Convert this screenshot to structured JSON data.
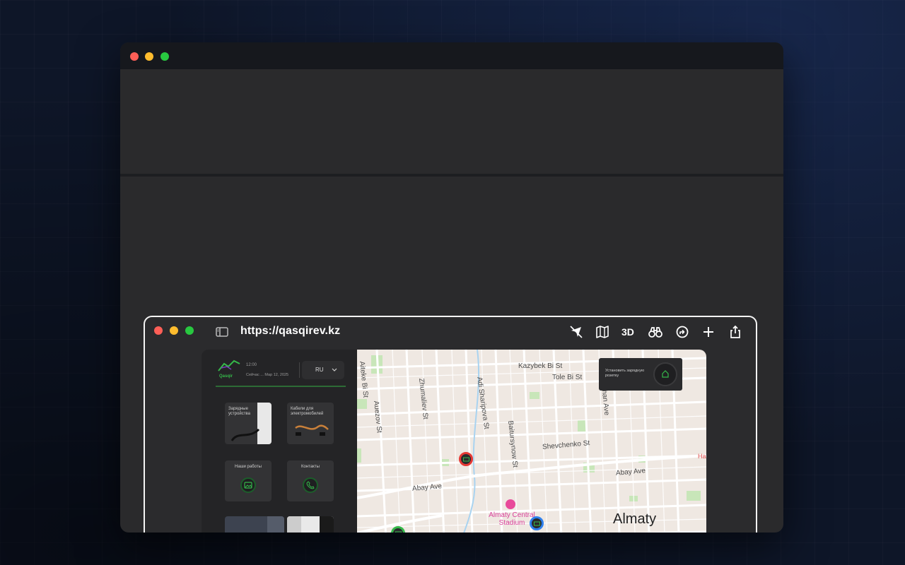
{
  "browser": {
    "url": "https://qasqirev.kz",
    "toolbar_3d_label": "3D",
    "icons": [
      "sidebar-icon",
      "airplane-icon",
      "map-icon",
      "binoculars-icon",
      "route-icon",
      "plus-icon",
      "share-icon"
    ]
  },
  "site": {
    "logo_text": "Qasqir",
    "header_line1": "12:00",
    "header_line2": "Сейчас ... Мар 12, 2025",
    "language": "RU",
    "cards": [
      {
        "title": "Зарядные устройства"
      },
      {
        "title": "Кабели для электромобилей"
      },
      {
        "title": "Наши работы"
      },
      {
        "title": "Контакты"
      }
    ]
  },
  "map": {
    "city": "Almaty",
    "streets": [
      "Kazybek Bi St",
      "Tole Bi St",
      "Zhumaliev St",
      "Adi Sharipova St",
      "Aiteke Bi St",
      "Auezov St",
      "Baitursynow St",
      "Shevchenko St",
      "Abay Ave",
      "Khan Ave"
    ],
    "landmark": "Almaty Central Stadium",
    "overlay_text": "Установить зарядную розетку",
    "accent_green": "#35b84a",
    "pin_red": "#e53935",
    "pin_blue": "#2f80ed"
  }
}
